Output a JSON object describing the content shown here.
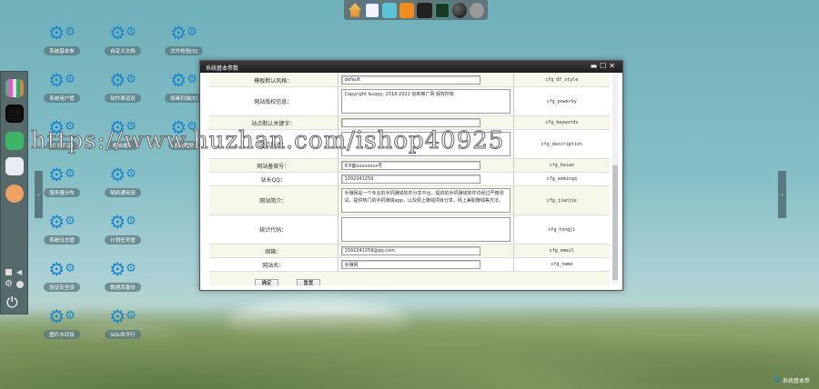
{
  "taskbar": {
    "icons": [
      "home-icon",
      "document-icon",
      "toolbox-icon",
      "orange-app-icon",
      "card-stack-icon",
      "user-icon",
      "ball-icon",
      "gear-cloud-icon"
    ]
  },
  "desktop": {
    "icons": [
      {
        "label": "系统基本参"
      },
      {
        "label": "系统用户管"
      },
      {
        "label": "会员设定"
      },
      {
        "label": "服务器分布"
      },
      {
        "label": "系统日志管"
      },
      {
        "label": "验证安全设"
      },
      {
        "label": "图片水印设"
      },
      {
        "label": "自定义文档"
      },
      {
        "label": "软件渠道设"
      },
      {
        "label": "模板缓存"
      },
      {
        "label": "随机通用设"
      },
      {
        "label": "计划任务管"
      },
      {
        "label": "数据库备份"
      },
      {
        "label": "SQL命令行"
      },
      {
        "label": "文件校验[S]"
      },
      {
        "label": "病毒扫描[S]"
      },
      {
        "label": "系统帮助"
      }
    ]
  },
  "dialog": {
    "title": "系统基本参数",
    "rows": [
      {
        "label": "模板默认风格：",
        "value": "default",
        "var": "cfg_df_style",
        "type": "input"
      },
      {
        "label": "网站版权信息：",
        "value": "Copyright &copy; 2018-2022 创新推广网 版权所有",
        "var": "cfg_powerby",
        "type": "textarea"
      },
      {
        "label": "站点默认关键字：",
        "value": "",
        "var": "cfg_keywords",
        "type": "input"
      },
      {
        "label": "站点描述：",
        "value": "",
        "var": "cfg_description",
        "type": "textarea"
      },
      {
        "label": "网站备案号：",
        "value": "ICP备xxxxxxxx号",
        "var": "cfg_beian",
        "type": "input"
      },
      {
        "label": "站长QQ：",
        "value": "1002241259",
        "var": "cfg_adminqq",
        "type": "input"
      },
      {
        "label": "网站简介：",
        "value": "手赚网是一个专业的手机赚钱软件分享平台，提供的手机赚钱软件均经过严格测试，提供热门的手机赚钱app，以及网上赚钱项目分享，网上兼职赚钱等方法。",
        "var": "cfg_jianjie",
        "type": "textarea"
      },
      {
        "label": "统计代码：",
        "value": "",
        "var": "cfg_tongji",
        "type": "textarea"
      },
      {
        "label": "邮箱：",
        "value": "1002241259@qq.com",
        "var": "cfg_email",
        "type": "input"
      },
      {
        "label": "网站名：",
        "value": "手赚网",
        "var": "cfg_name",
        "type": "input"
      }
    ],
    "ok_label": "确定",
    "reset_label": "重置"
  },
  "watermark": "https://www.huzhan.com/ishop40925",
  "brand": "系统基本参"
}
